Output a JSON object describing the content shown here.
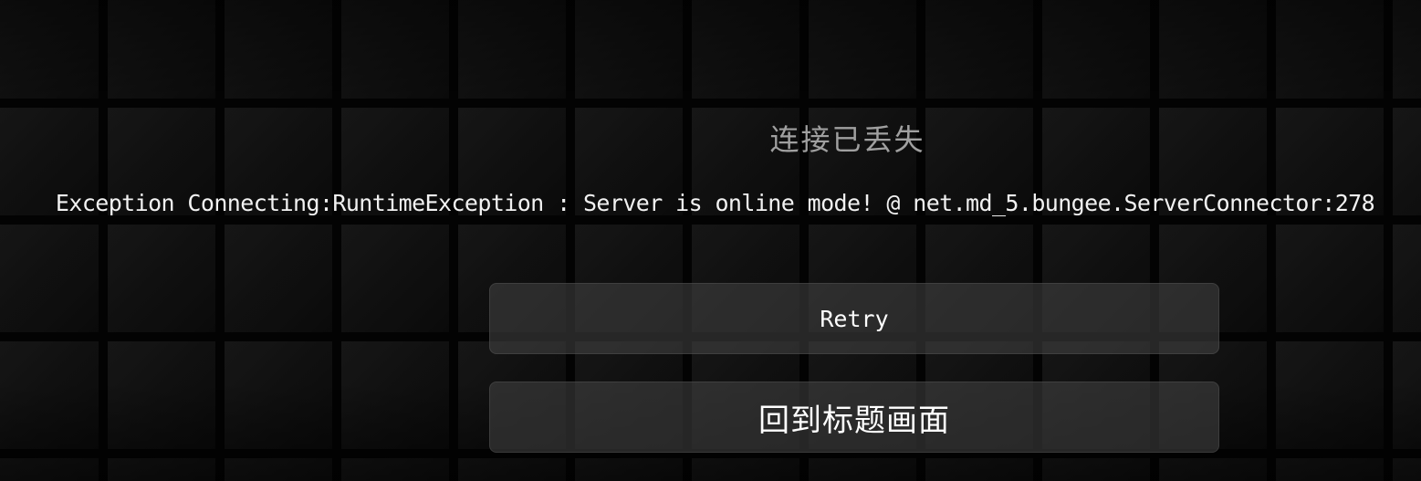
{
  "disconnect": {
    "title": "连接已丢失",
    "message": "Exception Connecting:RuntimeException : Server is online mode! @ net.md_5.bungee.ServerConnector:278"
  },
  "buttons": {
    "retry_label": "Retry",
    "back_to_title_label": "回到标题画面"
  },
  "colors": {
    "title_text": "#a0a0a0",
    "message_text": "#f2f2f2",
    "button_text": "#ffffff",
    "button_bg": "#3a3a3a"
  }
}
